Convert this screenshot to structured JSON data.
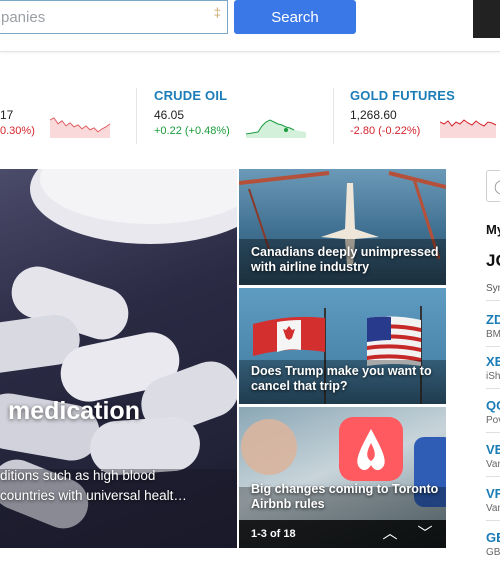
{
  "search": {
    "placeholder": "panies",
    "button_label": "Search"
  },
  "ticker": [
    {
      "name": "",
      "value": "17",
      "change": "0.30%)",
      "direction": "down"
    },
    {
      "name": "CRUDE OIL",
      "value": "46.05",
      "change": "+0.22 (+0.48%)",
      "direction": "up"
    },
    {
      "name": "GOLD FUTURES",
      "value": "1,268.60",
      "change": "-2.80 (-0.22%)",
      "direction": "down"
    }
  ],
  "hero": {
    "title": "medication",
    "description": "ditions such as high blood countries with universal healt…"
  },
  "stories": [
    {
      "caption": "Canadians deeply unimpressed with airline industry"
    },
    {
      "caption": "Does Trump make you want to cancel that trip?"
    },
    {
      "caption": "Big changes coming to Toronto Airbnb rules"
    }
  ],
  "slider": {
    "count": "1-3 of 18",
    "up_glyph": "︿",
    "down_glyph": "﹀"
  },
  "sidebar": {
    "heading_1": "My",
    "heading_2": "JO",
    "subheading": "Sym",
    "rows": [
      {
        "symbol": "ZD",
        "name": "BM"
      },
      {
        "symbol": "XE",
        "name": "iSh"
      },
      {
        "symbol": "QC",
        "name": "Pov"
      },
      {
        "symbol": "VE",
        "name": "Van"
      },
      {
        "symbol": "VF",
        "name": "Van"
      },
      {
        "symbol": "GE",
        "name": "GB"
      }
    ]
  },
  "colors": {
    "accent_blue": "#3b78e7",
    "link_blue": "#1b7db8",
    "negative": "#d4242c",
    "positive": "#1a9c3c"
  }
}
